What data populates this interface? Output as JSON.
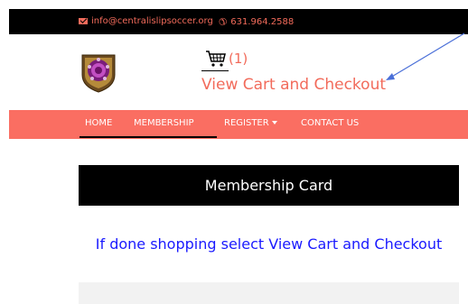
{
  "topbar": {
    "email": "info@centralislipsoccer.org",
    "phone": "631.964.2588",
    "email_icon": "envelope-icon",
    "phone_icon": "phone-icon"
  },
  "header": {
    "logo_icon": "club-crest-logo",
    "cart_icon": "shopping-cart-icon",
    "cart_count": "(1)",
    "checkout_link": "View Cart and Checkout"
  },
  "nav": {
    "items": [
      {
        "label": "HOME"
      },
      {
        "label": "MEMBERSHIP"
      },
      {
        "label": "REGISTER"
      },
      {
        "label": "CONTACT US"
      }
    ],
    "register_icon": "caret-down-icon"
  },
  "main": {
    "card_title": "Membership Card",
    "instruction": "If done shopping select View Cart and Checkout"
  },
  "colors": {
    "accent": "#f26b5b",
    "nav_bg": "#fa6e62",
    "topbar_bg": "#000000",
    "link_blue": "#1a1aff",
    "arrow": "#4a6fd8"
  }
}
